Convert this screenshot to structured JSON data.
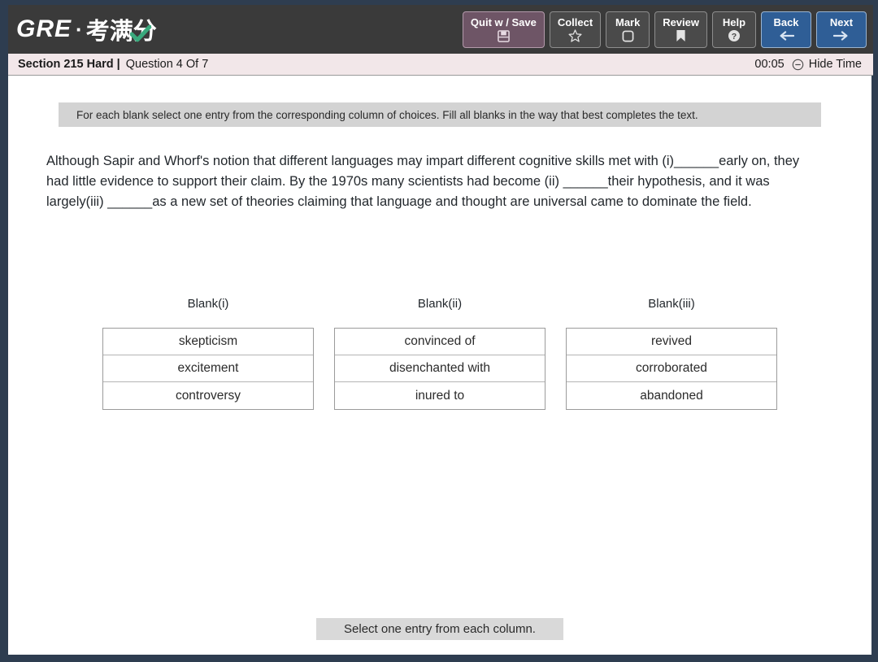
{
  "brand": {
    "gre": "GRE",
    "separator": "·",
    "chinese": "考满分",
    "check_icon": "green-check-icon"
  },
  "toolbar": {
    "buttons": [
      {
        "label": "Quit w / Save",
        "icon": "save-floppy-icon",
        "style": "quit"
      },
      {
        "label": "Collect",
        "icon": "star-icon",
        "style": "default"
      },
      {
        "label": "Mark",
        "icon": "square-checkbox-icon",
        "style": "default"
      },
      {
        "label": "Review",
        "icon": "bookmark-icon",
        "style": "default"
      },
      {
        "label": "Help",
        "icon": "question-circle-icon",
        "style": "default"
      },
      {
        "label": "Back",
        "icon": "arrow-left-icon",
        "style": "nav"
      },
      {
        "label": "Next",
        "icon": "arrow-right-icon",
        "style": "nav"
      }
    ]
  },
  "status": {
    "section": "Section 215 Hard",
    "divider": "|",
    "question": "Question 4 Of 7",
    "timer": "00:05",
    "hide_time_label": "Hide Time",
    "hide_time_icon": "minus-circle-icon"
  },
  "directions": {
    "text": "For each blank select one entry from the corresponding column of choices. Fill all blanks in the way that best completes the text."
  },
  "passage": {
    "text": "Although Sapir and Whorf's notion that different languages may impart different cognitive skills met with (i)______early on, they had little evidence to support their claim. By the 1970s many scientists had become (ii) ______their hypothesis, and it was largely(iii) ______as a new set of theories claiming that language and thought are universal came to dominate the field."
  },
  "blanks": [
    {
      "heading": "Blank(i)",
      "options": [
        "skepticism",
        "excitement",
        "controversy"
      ]
    },
    {
      "heading": "Blank(ii)",
      "options": [
        "convinced of",
        "disenchanted with",
        "inured to"
      ]
    },
    {
      "heading": "Blank(iii)",
      "options": [
        "revived",
        "corroborated",
        "abandoned"
      ]
    }
  ],
  "footer": {
    "hint": "Select one entry from each column."
  },
  "colors": {
    "frame": "#2e3d50",
    "toolbar": "#3a3a3a",
    "quit_button": "#6e5566",
    "nav_button": "#2f5e96",
    "status_strip": "#f2e7e9",
    "directions_bar": "#d3d3d3",
    "footer_bar": "#d9d9d9",
    "logo_check": "#3aaa7d"
  }
}
